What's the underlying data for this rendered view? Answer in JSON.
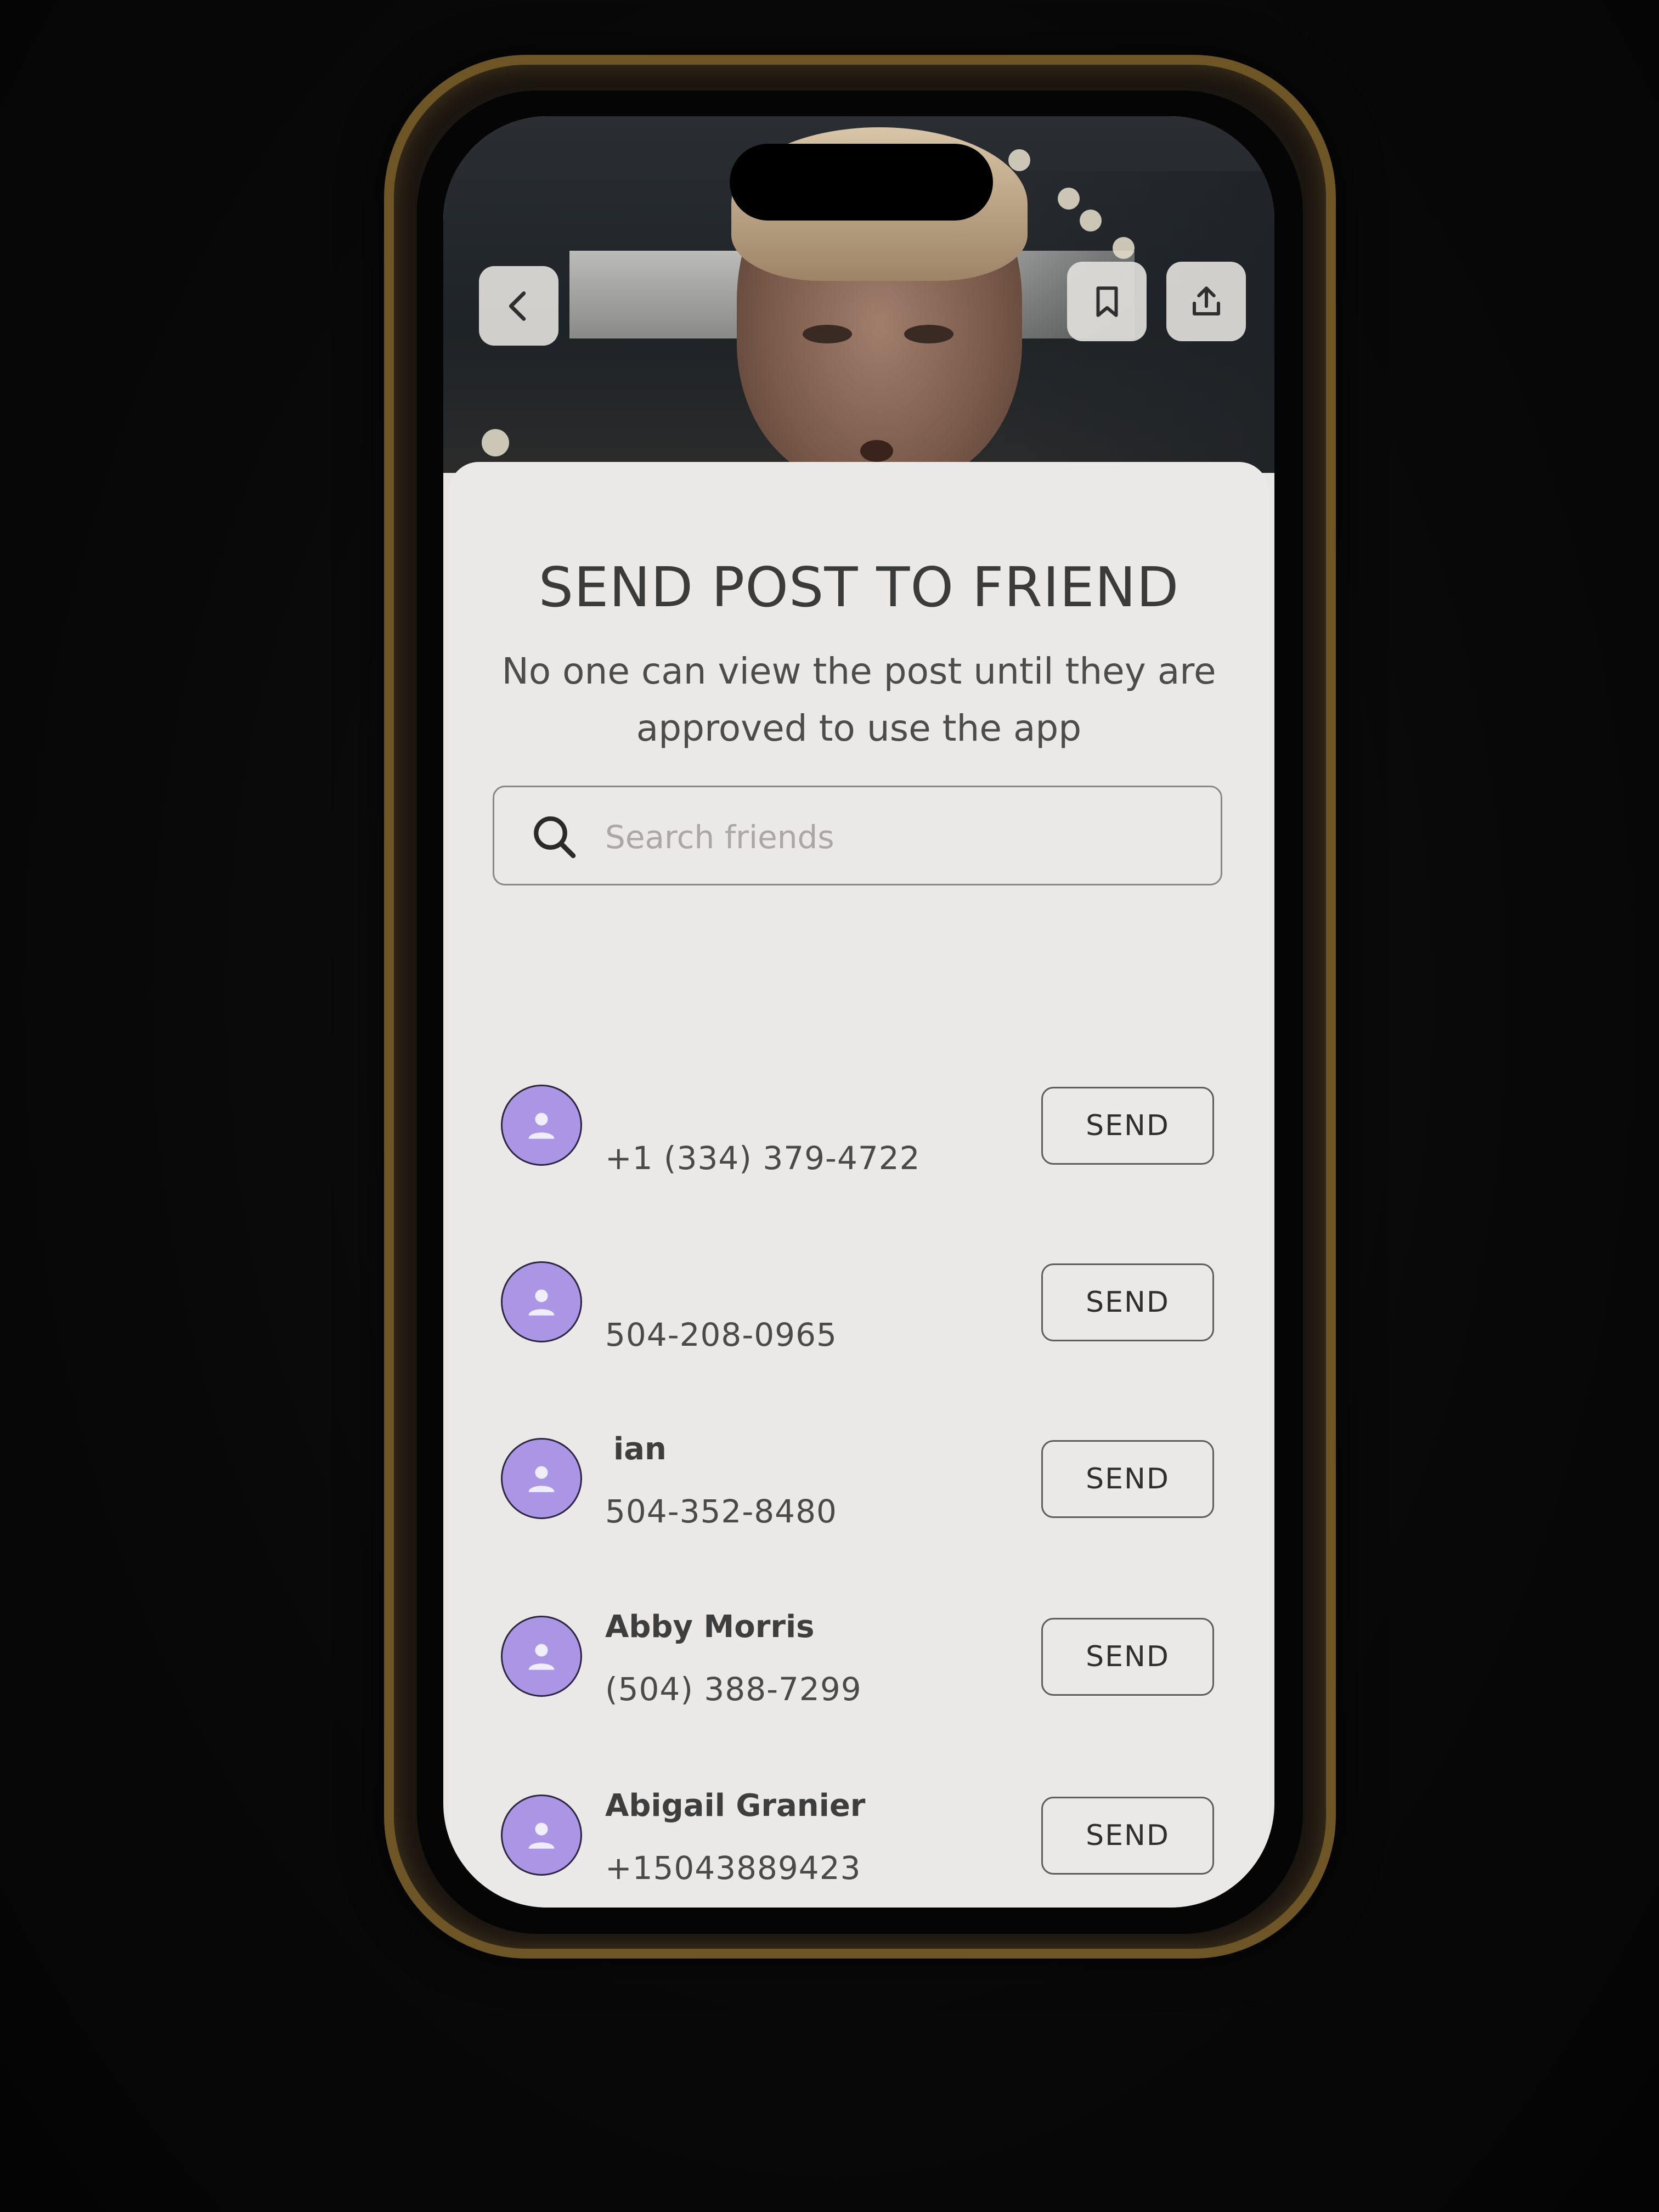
{
  "header": {
    "back_icon": "chevron-left-icon",
    "bookmark_icon": "bookmark-icon",
    "share_icon": "share-icon"
  },
  "sheet": {
    "title": "SEND POST TO FRIEND",
    "subtitle_line1": "No one can view the post until they are",
    "subtitle_line2": "approved to use the app",
    "search": {
      "placeholder": "Search friends",
      "value": ""
    },
    "send_label": "SEND",
    "avatar_color": "#ab96e6",
    "contacts": [
      {
        "name": "",
        "phone": "+1 (334) 379-4722"
      },
      {
        "name": "",
        "phone": "504-208-0965"
      },
      {
        "name": "ian",
        "phone": "504-352-8480"
      },
      {
        "name": "Abby Morris",
        "phone": "(504) 388-7299"
      },
      {
        "name": "Abigail Granier",
        "phone": "+15043889423"
      }
    ]
  }
}
